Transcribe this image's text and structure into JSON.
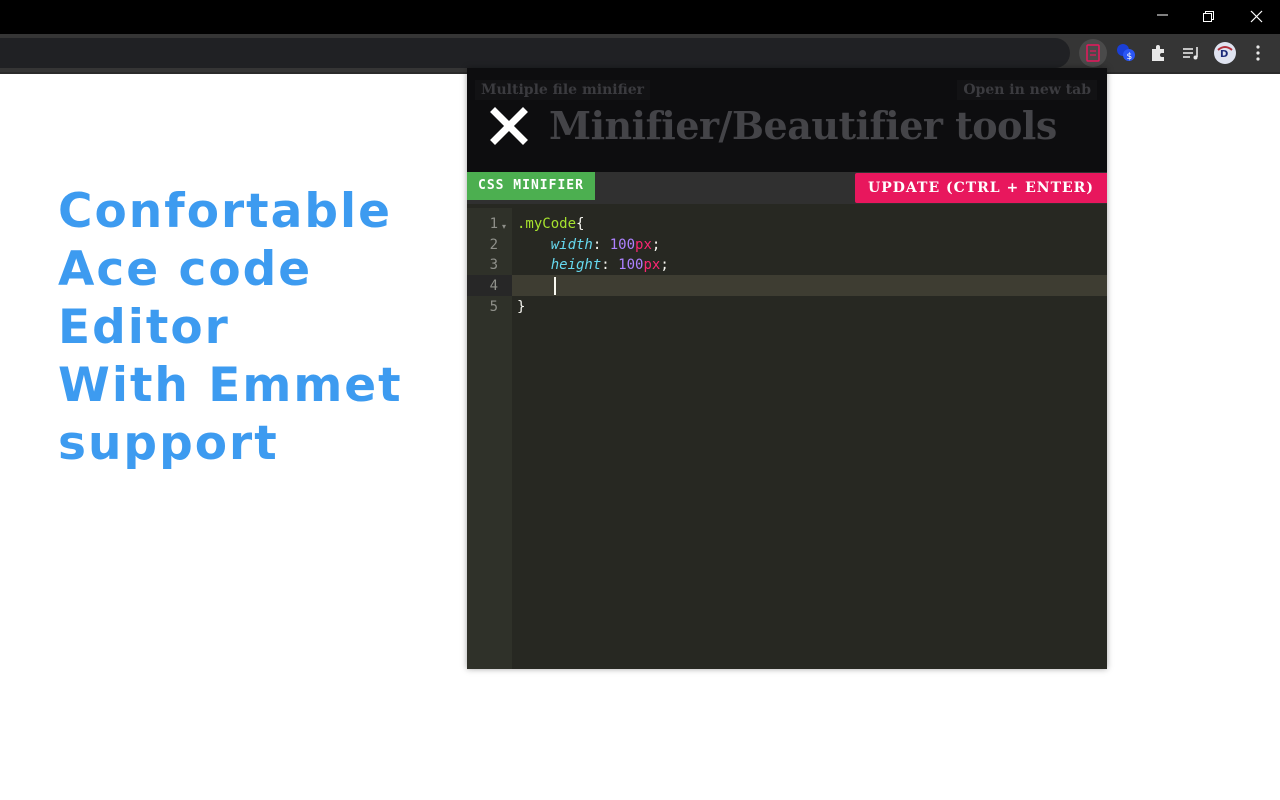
{
  "window": {
    "controls": [
      "minimize-icon",
      "restore-icon",
      "close-icon"
    ]
  },
  "toolbar": {
    "extensions": [
      "minifier-extension-icon",
      "currency-extension-icon",
      "puzzle-icon",
      "media-queue-icon",
      "profile-avatar",
      "kebab-menu-icon"
    ]
  },
  "promo": {
    "lines": [
      "Confortable",
      "Ace code",
      "Editor",
      "With Emmet",
      "support"
    ],
    "color": "#3d9bf0"
  },
  "popup": {
    "header": {
      "left_link": "Multiple file minifier",
      "right_link": "Open in new tab",
      "title": "Minifier/Beautifier tools"
    },
    "mode_badge": "CSS MINIFIER",
    "update_button": "UPDATE (CTRL + ENTER)",
    "colors": {
      "badge": "#4caf50",
      "update": "#e8175d"
    }
  },
  "editor": {
    "line_numbers": [
      "1",
      "2",
      "3",
      "4",
      "5"
    ],
    "active_line": 4,
    "code": {
      "l1_selector": ".myCode",
      "l1_brace": "{",
      "l2_prop": "width",
      "l2_colon": ": ",
      "l2_num": "100",
      "l2_unit": "px",
      "l2_semi": ";",
      "l3_prop": "height",
      "l3_colon": ": ",
      "l3_num": "100",
      "l3_unit": "px",
      "l3_semi": ";",
      "l5_brace": "}"
    }
  }
}
